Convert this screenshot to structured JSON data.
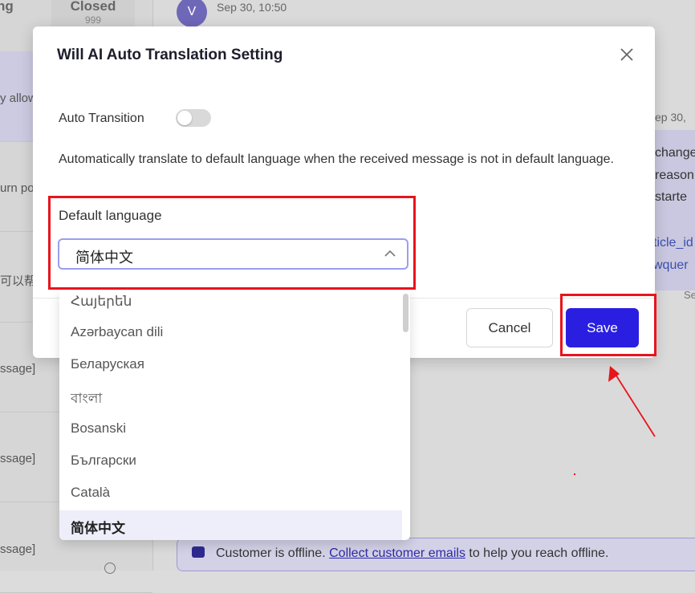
{
  "background": {
    "tabs": [
      "ng",
      "Closed"
    ],
    "closed_count": "999",
    "rows": [
      {
        "snippet": "y allow",
        "highlight": true
      },
      {
        "snippet": "urn po",
        "highlight": false
      },
      {
        "snippet": "可以帮助",
        "highlight": false
      },
      {
        "snippet": "ssage]",
        "highlight": false
      },
      {
        "snippet": "ssage]",
        "highlight": false
      },
      {
        "snippet": "ssage]",
        "highlight": false
      }
    ],
    "avatar_letter": "V",
    "timestamp": "Sep 30, 10:50",
    "timestamp2": "ep 30,",
    "bubble_lines": [
      "change",
      "reason",
      "starte"
    ],
    "bubble_links": [
      "ticle_id",
      "wquer"
    ],
    "bubble_footer": "Se",
    "offline_before": "Customer is offline.",
    "offline_link": "Collect customer emails",
    "offline_after": "to help you reach offline."
  },
  "modal": {
    "title": "Will AI Auto Translation Setting",
    "toggle_label": "Auto Transition",
    "toggle_on": false,
    "description": "Automatically translate to default language when the received message is not in default language.",
    "language_label": "Default language",
    "selected_language": "简体中文",
    "cancel_label": "Cancel",
    "save_label": "Save"
  },
  "dropdown": {
    "options": [
      "Հայերեն",
      "Azərbaycan dili",
      "Беларуская",
      "বাংলা",
      "Bosanski",
      "Български",
      "Català",
      "简体中文"
    ],
    "selected_index": 7
  },
  "colors": {
    "primary": "#2a1fe0",
    "annotation": "#e8141c",
    "select_border": "#9a9ef0"
  }
}
